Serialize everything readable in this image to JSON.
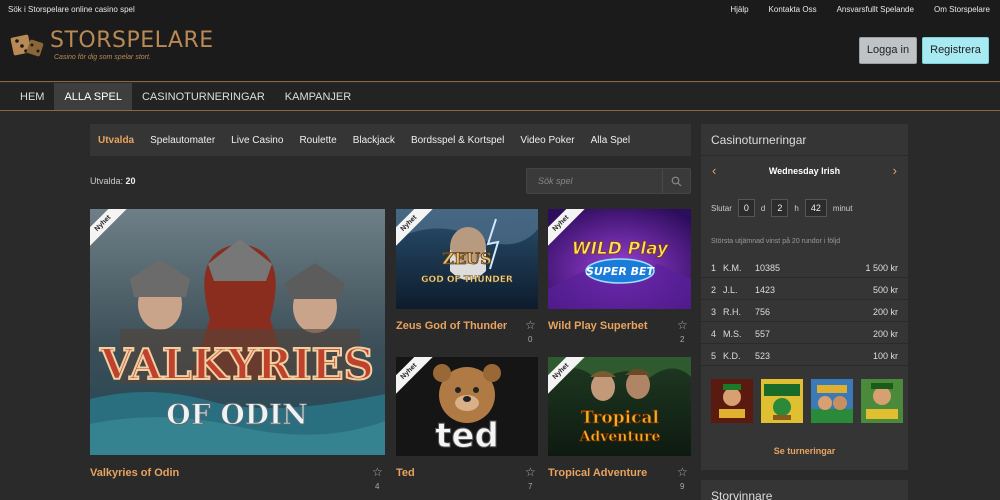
{
  "top_bar": {
    "tagline": "Sök i Storspelare online casino spel",
    "links": [
      "Hjälp",
      "Kontakta Oss",
      "Ansvarsfullt Spelande",
      "Om Storspelare"
    ]
  },
  "header": {
    "brand": "STORSPELARE",
    "slogan": "Casino för dig som spelar stort.",
    "login_label": "Logga in",
    "register_label": "Registrera"
  },
  "main_nav": {
    "items": [
      "HEM",
      "ALLA SPEL",
      "CASINOTURNERINGAR",
      "KAMPANJER"
    ],
    "active": "ALLA SPEL"
  },
  "sub_nav": {
    "items": [
      "Utvalda",
      "Spelautomater",
      "Live Casino",
      "Roulette",
      "Blackjack",
      "Bordsspel & Kortspel",
      "Video Poker",
      "Alla Spel"
    ],
    "active": "Utvalda"
  },
  "games_header": {
    "label": "Utvalda:",
    "count": "20",
    "search_placeholder": "Sök spel"
  },
  "games": [
    {
      "title": "Valkyries of Odin",
      "badge": "Nyhet",
      "favorites": "4",
      "art_line1": "VALKYRIES",
      "art_line2": "OF ODIN"
    },
    {
      "title": "Zeus God of Thunder",
      "badge": "Nyhet",
      "favorites": "0",
      "art_line1": "ZEUS",
      "art_line2": "GOD OF THUNDER"
    },
    {
      "title": "Wild Play Superbet",
      "badge": "Nyhet",
      "favorites": "2",
      "art_line1": "WILD Play",
      "art_line2": "SUPER BET"
    },
    {
      "title": "Ted",
      "badge": "Nyhet",
      "favorites": "7",
      "art_line1": "ted",
      "art_line2": ""
    },
    {
      "title": "Tropical Adventure",
      "badge": "Nyhet",
      "favorites": "9",
      "art_line1": "Tropical",
      "art_line2": "Adventure"
    }
  ],
  "tournaments": {
    "heading": "Casinoturneringar",
    "current": "Wednesday Irish",
    "ends_label": "Slutar",
    "days": "0",
    "days_unit": "d",
    "hours": "2",
    "hours_unit": "h",
    "minutes": "42",
    "minutes_unit": "minut",
    "note": "Största utjämnad vinst på 20 rundor i följd",
    "leaderboard": [
      {
        "rank": "1",
        "name": "K.M.",
        "points": "10385",
        "prize": "1 500 kr"
      },
      {
        "rank": "2",
        "name": "J.L.",
        "points": "1423",
        "prize": "500 kr"
      },
      {
        "rank": "3",
        "name": "R.H.",
        "points": "756",
        "prize": "200 kr"
      },
      {
        "rank": "4",
        "name": "M.S.",
        "points": "557",
        "prize": "200 kr"
      },
      {
        "rank": "5",
        "name": "K.D.",
        "points": "523",
        "prize": "100 kr"
      }
    ],
    "see_all_label": "Se turneringar"
  },
  "next_section": {
    "heading": "Storvinnare"
  },
  "colors": {
    "accent": "#e8a35f",
    "brand": "#b98a56",
    "register_button": "#a7eaf2",
    "login_button": "#bfc3c6"
  },
  "icons": {
    "logo": "dice-logo-icon",
    "search": "search-icon",
    "prev": "chevron-left-icon",
    "next": "chevron-right-icon",
    "favorite": "star-icon"
  }
}
